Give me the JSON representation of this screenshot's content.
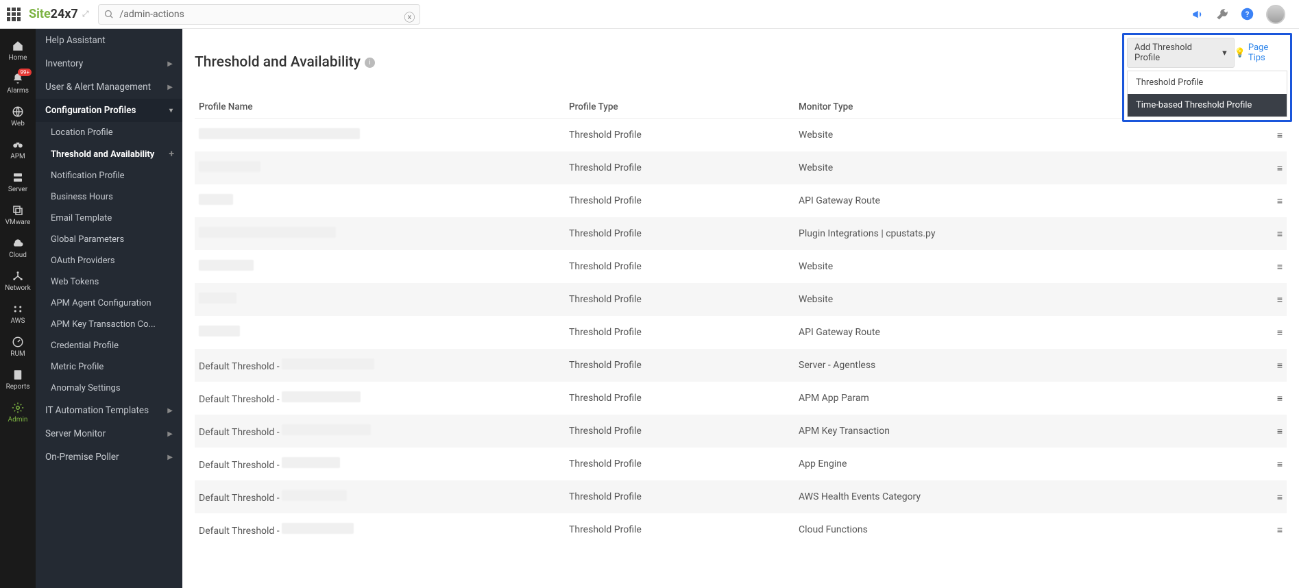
{
  "header": {
    "logo_green": "Site",
    "logo_dark": "24x7",
    "search_value": "/admin-actions"
  },
  "rail": [
    {
      "label": "Home",
      "icon": "home"
    },
    {
      "label": "Alarms",
      "icon": "bell",
      "badge": "99+"
    },
    {
      "label": "Web",
      "icon": "globe"
    },
    {
      "label": "APM",
      "icon": "binoc"
    },
    {
      "label": "Server",
      "icon": "server"
    },
    {
      "label": "VMware",
      "icon": "layers"
    },
    {
      "label": "Cloud",
      "icon": "cloud"
    },
    {
      "label": "Network",
      "icon": "network"
    },
    {
      "label": "AWS",
      "icon": "aws"
    },
    {
      "label": "RUM",
      "icon": "gauge"
    },
    {
      "label": "Reports",
      "icon": "report"
    },
    {
      "label": "Admin",
      "icon": "gear",
      "active": true
    }
  ],
  "sidenav": {
    "top": [
      {
        "label": "Help Assistant"
      },
      {
        "label": "Inventory",
        "chev": true
      },
      {
        "label": "User & Alert Management",
        "chev": true
      }
    ],
    "section_label": "Configuration Profiles",
    "subs": [
      {
        "label": "Location Profile"
      },
      {
        "label": "Threshold and Availability",
        "active": true,
        "plus": true
      },
      {
        "label": "Notification Profile"
      },
      {
        "label": "Business Hours"
      },
      {
        "label": "Email Template"
      },
      {
        "label": "Global Parameters"
      },
      {
        "label": "OAuth Providers"
      },
      {
        "label": "Web Tokens"
      },
      {
        "label": "APM Agent Configuration"
      },
      {
        "label": "APM Key Transaction Co..."
      },
      {
        "label": "Credential Profile"
      },
      {
        "label": "Metric Profile"
      },
      {
        "label": "Anomaly Settings"
      }
    ],
    "bottom": [
      {
        "label": "IT Automation Templates",
        "chev": true
      },
      {
        "label": "Server Monitor",
        "chev": true
      },
      {
        "label": "On-Premise Poller",
        "chev": true
      }
    ]
  },
  "page": {
    "title": "Threshold and Availability",
    "add_btn": "Add Threshold Profile",
    "page_tips": "Page Tips",
    "dropdown": {
      "item1": "Threshold Profile",
      "item2": "Time-based Threshold Profile"
    },
    "columns": {
      "name": "Profile Name",
      "type": "Profile Type",
      "monitor": "Monitor Type"
    },
    "rows": [
      {
        "name": "",
        "redact_w": 235,
        "type": "Threshold Profile",
        "monitor": "Website"
      },
      {
        "name": "",
        "redact_w": 90,
        "type": "Threshold Profile",
        "monitor": "Website"
      },
      {
        "name": "",
        "redact_w": 50,
        "type": "Threshold Profile",
        "monitor": "API Gateway Route"
      },
      {
        "name": "",
        "redact_w": 200,
        "type": "Threshold Profile",
        "monitor": "Plugin Integrations | cpustats.py"
      },
      {
        "name": "",
        "redact_w": 80,
        "type": "Threshold Profile",
        "monitor": "Website"
      },
      {
        "name": "",
        "redact_w": 55,
        "type": "Threshold Profile",
        "monitor": "Website"
      },
      {
        "name": "",
        "redact_w": 60,
        "type": "Threshold Profile",
        "monitor": "API Gateway Route"
      },
      {
        "name": "Default Threshold - ",
        "redact_w": 135,
        "type": "Threshold Profile",
        "monitor": "Server - Agentless"
      },
      {
        "name": "Default Threshold - ",
        "redact_w": 115,
        "type": "Threshold Profile",
        "monitor": "APM App Param"
      },
      {
        "name": "Default Threshold - ",
        "redact_w": 130,
        "type": "Threshold Profile",
        "monitor": "APM Key Transaction"
      },
      {
        "name": "Default Threshold - ",
        "redact_w": 85,
        "type": "Threshold Profile",
        "monitor": "App Engine"
      },
      {
        "name": "Default Threshold - ",
        "redact_w": 95,
        "type": "Threshold Profile",
        "monitor": "AWS Health Events Category"
      },
      {
        "name": "Default Threshold - ",
        "redact_w": 105,
        "type": "Threshold Profile",
        "monitor": "Cloud Functions"
      }
    ]
  }
}
